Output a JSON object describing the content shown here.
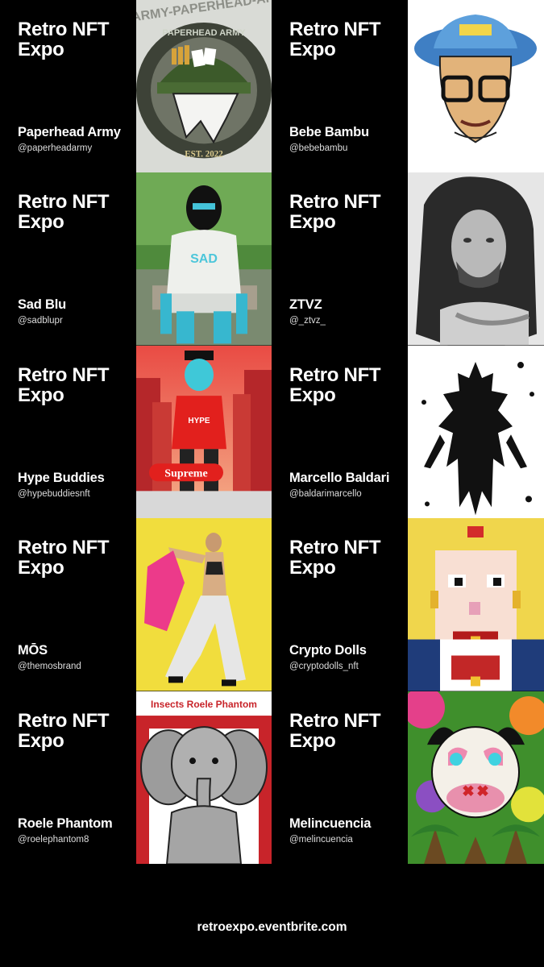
{
  "event_title": "Retro NFT Expo",
  "artists": [
    {
      "name": "Paperhead Army",
      "handle": "@paperheadarmy",
      "art_icon": "army-helmet-badge",
      "art_text_top": "PAPERHEAD ARMY",
      "art_text_bottom": "EST. 2022"
    },
    {
      "name": "Bebe Bambu",
      "handle": "@bebebambu",
      "art_icon": "bucket-hat-face"
    },
    {
      "name": "Sad Blu",
      "handle": "@sadblupr",
      "art_icon": "masked-blue-figure"
    },
    {
      "name": "ZTVZ",
      "handle": "@_ztvz_",
      "art_icon": "portrait-photo"
    },
    {
      "name": "Hype Buddies",
      "handle": "@hypebuddiesnft",
      "art_icon": "skater-character"
    },
    {
      "name": "Marcello Baldari",
      "handle": "@baldarimarcello",
      "art_icon": "ink-creature"
    },
    {
      "name": "MŌS",
      "handle": "@themosbrand",
      "art_icon": "fashion-model"
    },
    {
      "name": "Crypto Dolls",
      "handle": "@cryptodolls_nft",
      "art_icon": "pixel-doll"
    },
    {
      "name": "Roele Phantom",
      "handle": "@roelephantom8",
      "art_icon": "elephant",
      "art_text_top": "Insects Roele Phantom"
    },
    {
      "name": "Melincuencia",
      "handle": "@melincuencia",
      "art_icon": "cow-heart-glasses"
    }
  ],
  "footer_url": "retroexpo.eventbrite.com"
}
